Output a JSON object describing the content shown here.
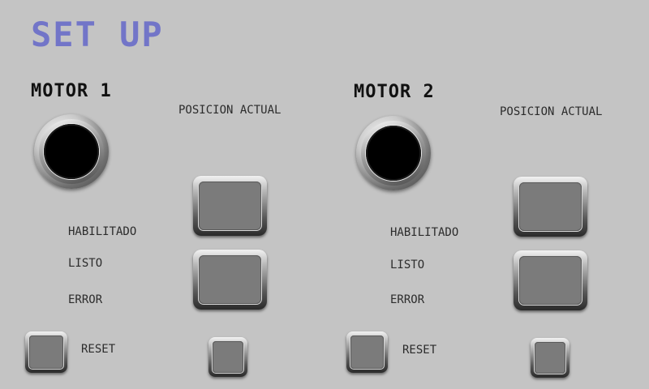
{
  "page": {
    "title": "SET UP"
  },
  "motors": [
    {
      "name": "MOTOR 1",
      "position_label": "POSICION ACTUAL",
      "status_labels": {
        "enabled": "HABILITADO",
        "ready": "LISTO",
        "error": "ERROR"
      },
      "reset_label": "RESET"
    },
    {
      "name": "MOTOR 2",
      "position_label": "POSICION ACTUAL",
      "status_labels": {
        "enabled": "HABILITADO",
        "ready": "LISTO",
        "error": "ERROR"
      },
      "reset_label": "RESET"
    }
  ],
  "colors": {
    "background": "#c4c4c4",
    "title": "#7275c8",
    "button_face": "#7b7b7b",
    "indicator": "#000000"
  }
}
